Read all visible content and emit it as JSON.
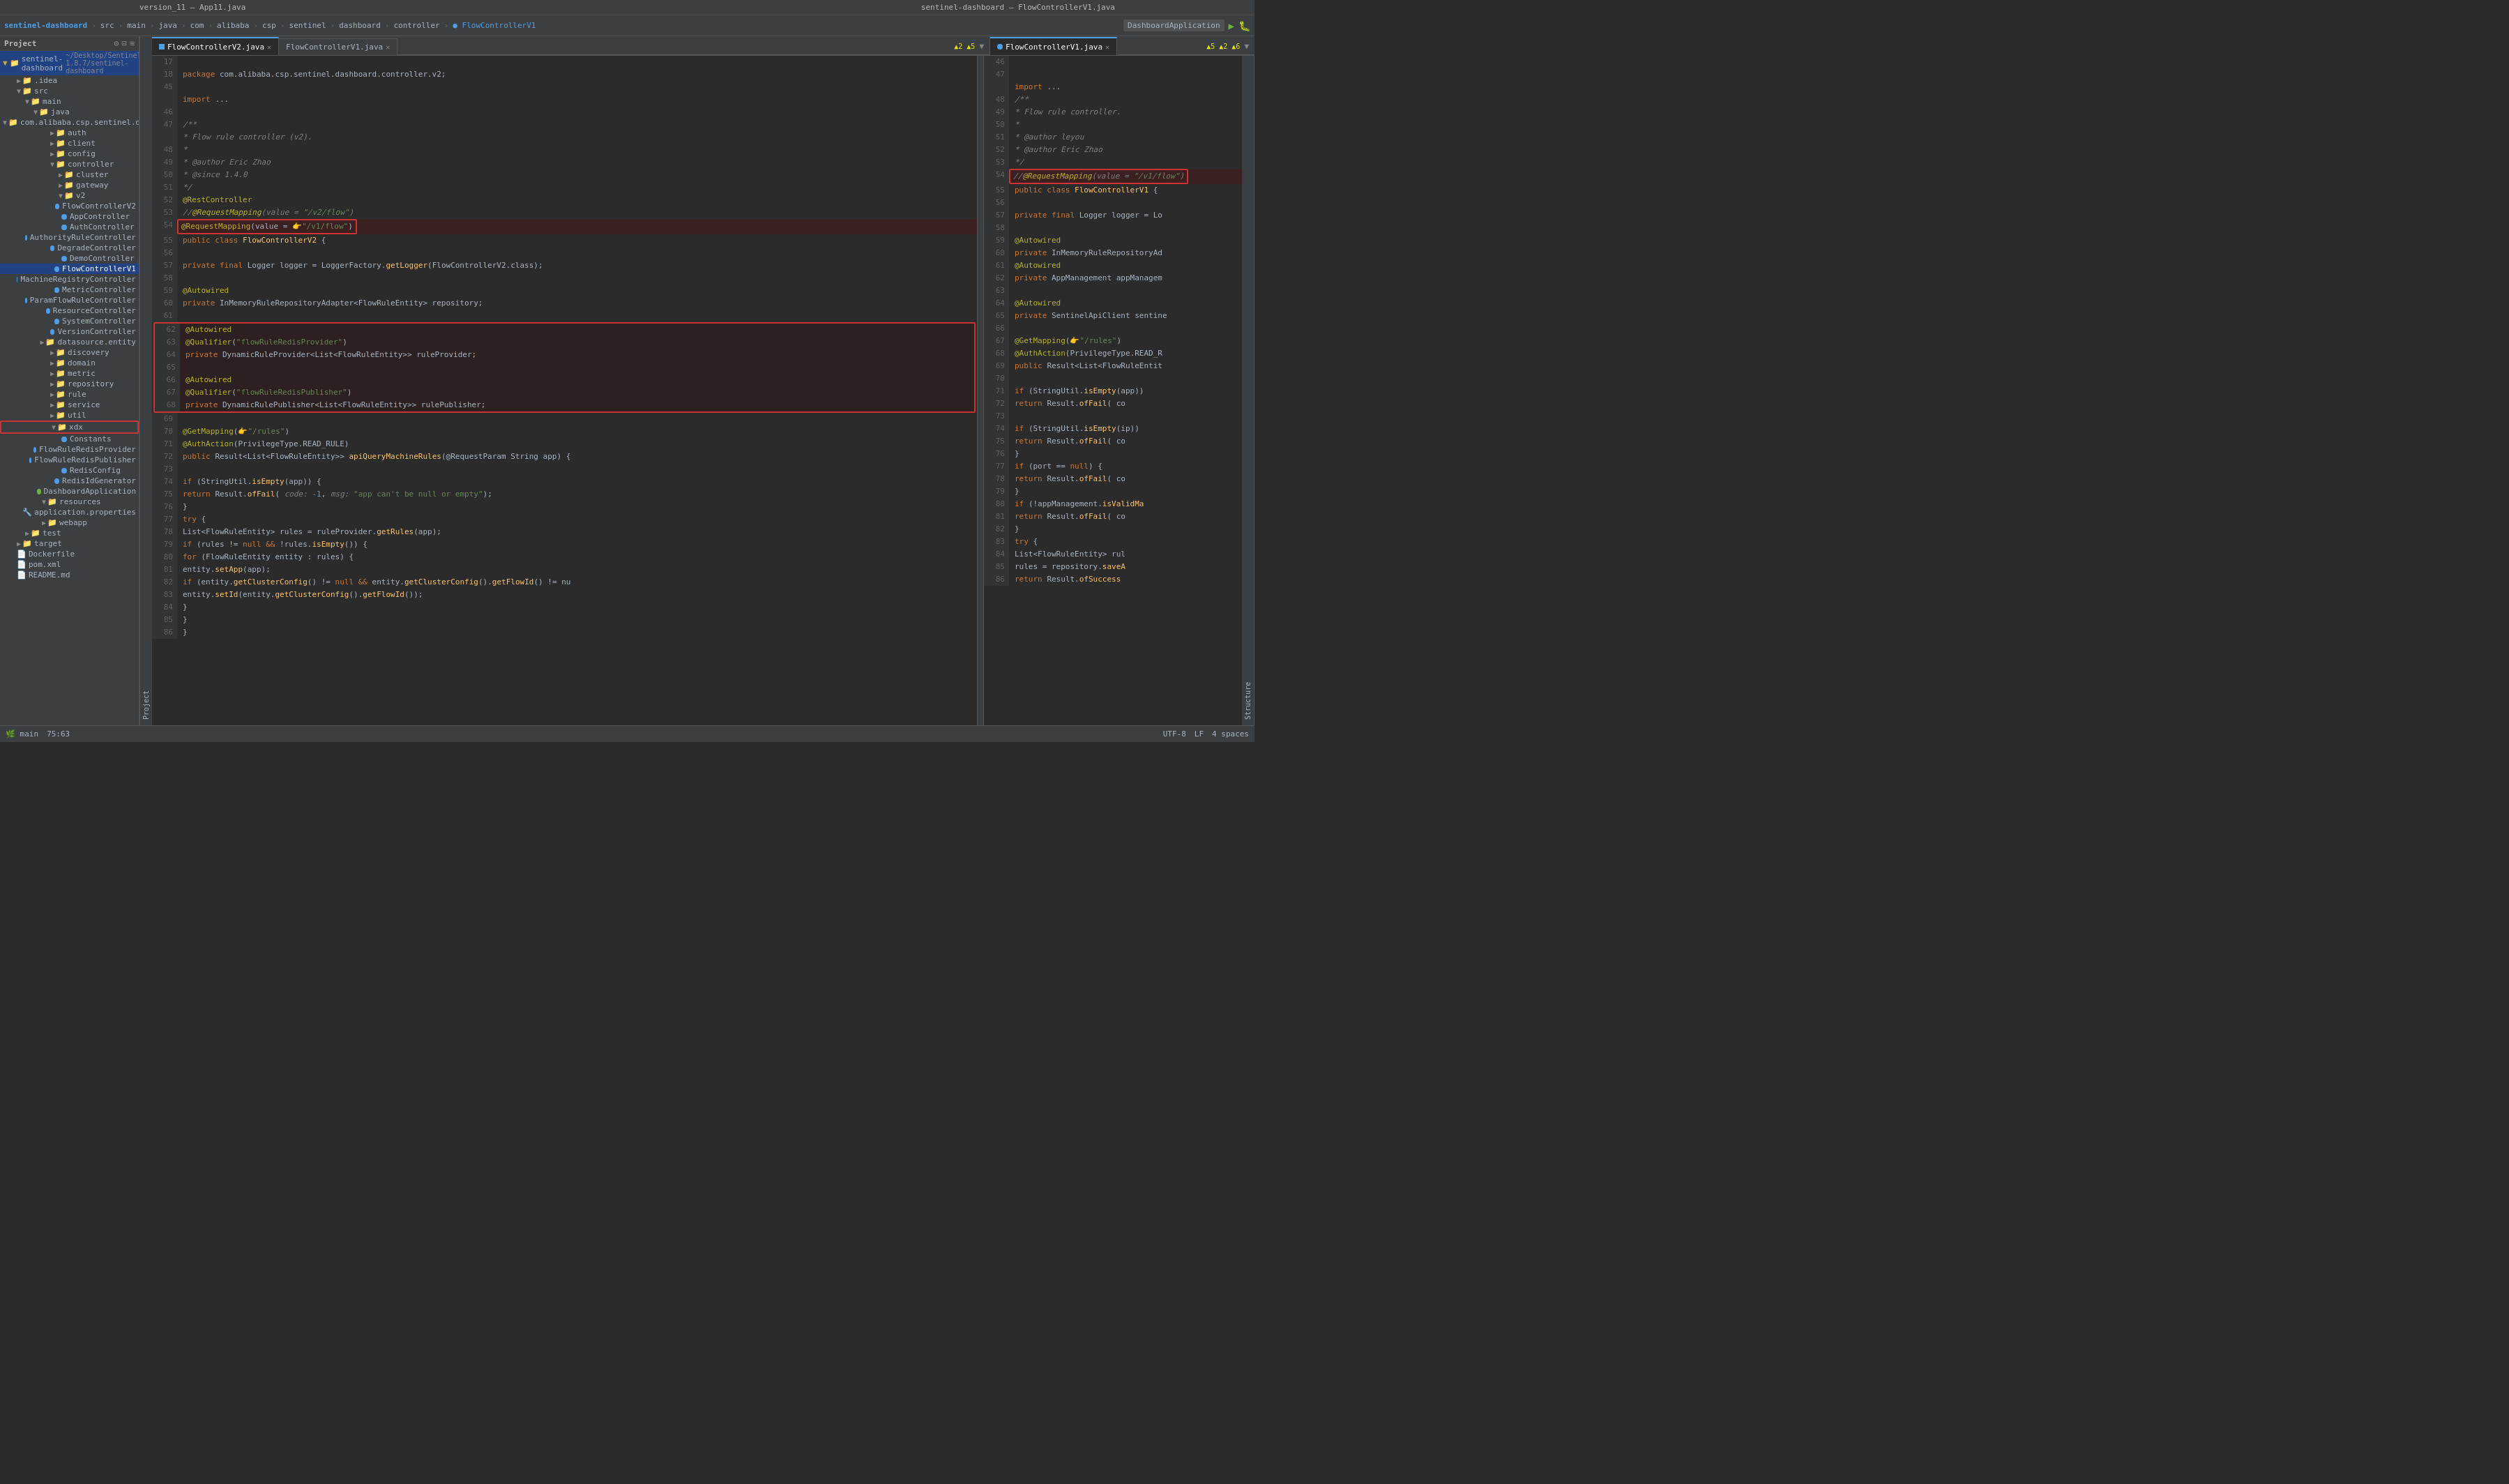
{
  "window": {
    "title_left": "version_11 – App11.java",
    "title_right": "sentinel-dashboard – FlowControllerV1.java"
  },
  "toolbar_left": {
    "project": "sentinel-dashboard",
    "breadcrumb": [
      "src",
      "main",
      "java",
      "com",
      "alibaba",
      "csp",
      "sentinel",
      "dashboard",
      "controller",
      "FlowControllerV1"
    ]
  },
  "toolbar_right": {
    "app": "DashboardApplication",
    "icons": [
      "play",
      "debug",
      "settings"
    ]
  },
  "tabs_left": [
    {
      "name": "FlowControllerV2.java",
      "active": true,
      "modified": false
    },
    {
      "name": "FlowControllerV1.java",
      "active": false,
      "modified": false
    }
  ],
  "tabs_right": [
    {
      "name": "FlowControllerV1.java",
      "active": true,
      "modified": false
    }
  ],
  "sidebar": {
    "project_label": "Project",
    "root": "sentinel-dashboard",
    "root_path": "~/Desktop/Sentinel-1.8.7/sentinel-dashboard",
    "tree": [
      {
        "label": ".idea",
        "type": "folder",
        "indent": 1
      },
      {
        "label": "src",
        "type": "folder",
        "indent": 1,
        "expanded": true
      },
      {
        "label": "main",
        "type": "folder",
        "indent": 2,
        "expanded": true
      },
      {
        "label": "java",
        "type": "folder",
        "indent": 3,
        "expanded": true
      },
      {
        "label": "com.alibaba.csp.sentinel.dashboard",
        "type": "folder",
        "indent": 4,
        "expanded": true
      },
      {
        "label": "auth",
        "type": "folder",
        "indent": 5
      },
      {
        "label": "client",
        "type": "folder",
        "indent": 5
      },
      {
        "label": "config",
        "type": "folder",
        "indent": 5
      },
      {
        "label": "controller",
        "type": "folder",
        "indent": 5,
        "expanded": true
      },
      {
        "label": "cluster",
        "type": "folder",
        "indent": 6
      },
      {
        "label": "gateway",
        "type": "folder",
        "indent": 6
      },
      {
        "label": "v2",
        "type": "folder",
        "indent": 6,
        "expanded": true
      },
      {
        "label": "FlowControllerV2",
        "type": "java",
        "indent": 7
      },
      {
        "label": "AppController",
        "type": "java",
        "indent": 6
      },
      {
        "label": "AuthController",
        "type": "java",
        "indent": 6
      },
      {
        "label": "AuthorityRuleController",
        "type": "java",
        "indent": 6
      },
      {
        "label": "DegradeController",
        "type": "java",
        "indent": 6
      },
      {
        "label": "DemoController",
        "type": "java",
        "indent": 6
      },
      {
        "label": "FlowControllerV1",
        "type": "java",
        "indent": 6,
        "selected": true
      },
      {
        "label": "MachineRegistryController",
        "type": "java",
        "indent": 6
      },
      {
        "label": "MetricController",
        "type": "java",
        "indent": 6
      },
      {
        "label": "ParamFlowRuleController",
        "type": "java",
        "indent": 6
      },
      {
        "label": "ResourceController",
        "type": "java",
        "indent": 6
      },
      {
        "label": "SystemController",
        "type": "java",
        "indent": 6
      },
      {
        "label": "VersionController",
        "type": "java",
        "indent": 6
      },
      {
        "label": "datasource.entity",
        "type": "folder",
        "indent": 5
      },
      {
        "label": "discovery",
        "type": "folder",
        "indent": 5
      },
      {
        "label": "domain",
        "type": "folder",
        "indent": 5
      },
      {
        "label": "metric",
        "type": "folder",
        "indent": 5
      },
      {
        "label": "repository",
        "type": "folder",
        "indent": 5
      },
      {
        "label": "rule",
        "type": "folder",
        "indent": 5
      },
      {
        "label": "service",
        "type": "folder",
        "indent": 5
      },
      {
        "label": "util",
        "type": "folder",
        "indent": 5
      },
      {
        "label": "xdx",
        "type": "folder",
        "indent": 5,
        "expanded": true,
        "highlighted": true
      },
      {
        "label": "Constants",
        "type": "java",
        "indent": 6
      },
      {
        "label": "FlowRuleRedisProvider",
        "type": "java",
        "indent": 6
      },
      {
        "label": "FlowRuleRedisPublisher",
        "type": "java",
        "indent": 6
      },
      {
        "label": "RedisConfig",
        "type": "java",
        "indent": 6
      },
      {
        "label": "RedisIdGenerator",
        "type": "java",
        "indent": 6
      },
      {
        "label": "DashboardApplication",
        "type": "java_main",
        "indent": 5
      },
      {
        "label": "resources",
        "type": "folder",
        "indent": 4
      },
      {
        "label": "application.properties",
        "type": "props",
        "indent": 5
      },
      {
        "label": "webapp",
        "type": "folder",
        "indent": 4
      },
      {
        "label": "test",
        "type": "folder",
        "indent": 3
      },
      {
        "label": "target",
        "type": "folder",
        "indent": 2
      },
      {
        "label": "Dockerfile",
        "type": "file",
        "indent": 2
      },
      {
        "label": "pom.xml",
        "type": "xml",
        "indent": 2
      },
      {
        "label": "README.md",
        "type": "md",
        "indent": 2
      }
    ]
  },
  "code_left": {
    "filename": "FlowControllerV2.java",
    "lines": [
      {
        "num": 17,
        "content": ""
      },
      {
        "num": 18,
        "content": "    package com.alibaba.csp.sentinel.dashboard.controller.v2;"
      },
      {
        "num": 45,
        "content": ""
      },
      {
        "num": 46,
        "content": "    /**"
      },
      {
        "num": 47,
        "content": "     * Flow rule controller (v2)."
      },
      {
        "num": 48,
        "content": "     *"
      },
      {
        "num": 49,
        "content": "     * @author Eric Zhao"
      },
      {
        "num": 50,
        "content": "     * @since 1.4.0"
      },
      {
        "num": 51,
        "content": "     */"
      },
      {
        "num": 52,
        "content": "    @RestController"
      },
      {
        "num": 53,
        "content": "    //@RequestMapping(value = \"/v2/flow\")"
      },
      {
        "num": 54,
        "content": "    @RequestMapping(value = ὄ9\"/v1/flow\")"
      },
      {
        "num": 55,
        "content": "    public class FlowControllerV2 {"
      },
      {
        "num": 56,
        "content": ""
      },
      {
        "num": 57,
        "content": "        private final Logger logger = LoggerFactory.getLogger(FlowControllerV2.class);"
      },
      {
        "num": 58,
        "content": ""
      },
      {
        "num": 59,
        "content": "        @Autowired"
      },
      {
        "num": 60,
        "content": "        private InMemoryRuleRepositoryAdapter<FlowRuleEntity> repository;"
      },
      {
        "num": 61,
        "content": ""
      },
      {
        "num": 62,
        "content": "        @Autowired"
      },
      {
        "num": 63,
        "content": "        @Qualifier(\"flowRuleRedisProvider\")"
      },
      {
        "num": 64,
        "content": "        private DynamicRuleProvider<List<FlowRuleEntity>> ruleProvider;"
      },
      {
        "num": 65,
        "content": ""
      },
      {
        "num": 66,
        "content": "        @Autowired"
      },
      {
        "num": 67,
        "content": "        @Qualifier(\"flowRuleRedisPublisher\")"
      },
      {
        "num": 68,
        "content": "        private DynamicRulePublisher<List<FlowRuleEntity>> rulePublisher;"
      },
      {
        "num": 69,
        "content": ""
      },
      {
        "num": 70,
        "content": "        @GetMapping(ὄ9\"/rules\")"
      },
      {
        "num": 71,
        "content": "        @AuthAction(PrivilegeType.READ_RULE)"
      },
      {
        "num": 72,
        "content": "        public Result<List<FlowRuleEntity>> apiQueryMachineRules(@RequestParam String app) {"
      },
      {
        "num": 73,
        "content": ""
      },
      {
        "num": 74,
        "content": "            if (StringUtil.isEmpty(app)) {"
      },
      {
        "num": 75,
        "content": "                return Result.ofFail( code: -1,  msg: \"app can't be null or empty\");"
      },
      {
        "num": 76,
        "content": "            }"
      },
      {
        "num": 77,
        "content": "            try {"
      },
      {
        "num": 78,
        "content": "                List<FlowRuleEntity> rules = ruleProvider.getRules(app);"
      },
      {
        "num": 79,
        "content": "                if (rules != null && !rules.isEmpty()) {"
      },
      {
        "num": 80,
        "content": "                    for (FlowRuleEntity entity : rules) {"
      },
      {
        "num": 81,
        "content": "                        entity.setApp(app);"
      },
      {
        "num": 82,
        "content": "                        if (entity.getClusterConfig() != null && entity.getClusterConfig().getFlowId() != nu"
      },
      {
        "num": 83,
        "content": "                            entity.setId(entity.getClusterConfig().getFlowId());"
      },
      {
        "num": 84,
        "content": "                        }"
      },
      {
        "num": 85,
        "content": "                    }"
      },
      {
        "num": 86,
        "content": "                }"
      }
    ]
  },
  "code_right": {
    "filename": "FlowControllerV1.java",
    "lines": [
      {
        "num": 46,
        "content": ""
      },
      {
        "num": 47,
        "content": ""
      },
      {
        "num": 48,
        "content": "    /**"
      },
      {
        "num": 49,
        "content": "     * Flow rule controller."
      },
      {
        "num": 50,
        "content": "     *"
      },
      {
        "num": 51,
        "content": "     * @author leyou"
      },
      {
        "num": 52,
        "content": "     * @author Eric Zhao"
      },
      {
        "num": 53,
        "content": "     */"
      },
      {
        "num": 54,
        "content": "    //@RequestMapping(value = \"/v1/flow\")"
      },
      {
        "num": 55,
        "content": "    public class FlowControllerV1 {"
      },
      {
        "num": 56,
        "content": ""
      },
      {
        "num": 57,
        "content": "        private final Logger logger = Lo"
      },
      {
        "num": 58,
        "content": ""
      },
      {
        "num": 59,
        "content": "        @Autowired"
      },
      {
        "num": 60,
        "content": "        private InMemoryRuleRepositoryAd"
      },
      {
        "num": 61,
        "content": "        @Autowired"
      },
      {
        "num": 62,
        "content": "        private AppManagement appManagem"
      },
      {
        "num": 63,
        "content": ""
      },
      {
        "num": 64,
        "content": "        @Autowired"
      },
      {
        "num": 65,
        "content": "        private SentinelApiClient sentine"
      },
      {
        "num": 66,
        "content": ""
      },
      {
        "num": 67,
        "content": "        @GetMapping(ὄ9\"/rules\")"
      },
      {
        "num": 68,
        "content": "        @AuthAction(PrivilegeType.READ_R"
      },
      {
        "num": 69,
        "content": "        public Result<List<FlowRuleEntit"
      },
      {
        "num": 70,
        "content": ""
      },
      {
        "num": 71,
        "content": "            if (StringUtil.isEmpty(app))"
      },
      {
        "num": 72,
        "content": "                return Result.ofFail( co"
      },
      {
        "num": 73,
        "content": ""
      },
      {
        "num": 74,
        "content": "            if (StringUtil.isEmpty(ip))"
      },
      {
        "num": 75,
        "content": "                return Result.ofFail( co"
      },
      {
        "num": 76,
        "content": "            }"
      },
      {
        "num": 77,
        "content": "            if (port == null) {"
      },
      {
        "num": 78,
        "content": "                return Result.ofFail( co"
      },
      {
        "num": 79,
        "content": "            }"
      },
      {
        "num": 80,
        "content": "            if (!appManagement.isValidMa"
      },
      {
        "num": 81,
        "content": "                return Result.ofFail( co"
      },
      {
        "num": 82,
        "content": "            }"
      },
      {
        "num": 83,
        "content": "            try {"
      },
      {
        "num": 84,
        "content": "                List<FlowRuleEntity> rul"
      },
      {
        "num": 85,
        "content": "                rules = repository.saveA"
      },
      {
        "num": 86,
        "content": "                return Result.ofSuccess"
      }
    ]
  },
  "status_bar": {
    "line_col": "75:63",
    "encoding": "UTF-8",
    "line_sep": "LF",
    "indent": "4 spaces"
  },
  "warnings_left": "▲2  ▲5",
  "warnings_right": "▲5  ▲2  ▲6"
}
